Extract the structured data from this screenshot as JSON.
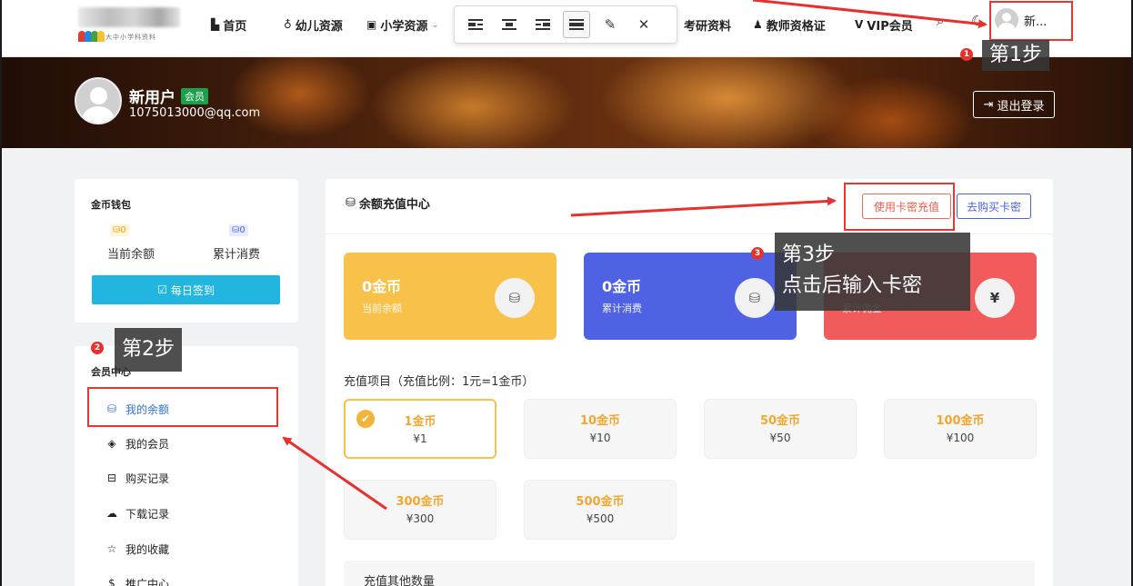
{
  "logo": {
    "subtitle": "大中小学科资料"
  },
  "nav": {
    "items": [
      {
        "label": "首页",
        "icon": "home-icon"
      },
      {
        "label": "幼儿资源",
        "icon": "child-icon"
      },
      {
        "label": "小学资源",
        "icon": "book-icon",
        "has_dropdown": true
      },
      {
        "label": "考研资料",
        "icon": "",
        "partial": true
      },
      {
        "label": "教师资格证",
        "icon": "teacher-icon"
      },
      {
        "label": "VIP会员",
        "icon": "vip-icon"
      }
    ],
    "user_label": "新..."
  },
  "toolbar": {
    "buttons": [
      {
        "name": "align-left-icon"
      },
      {
        "name": "align-center-icon"
      },
      {
        "name": "align-right-icon"
      },
      {
        "name": "align-full-icon",
        "active": true
      },
      {
        "name": "edit-pencil-icon"
      },
      {
        "name": "close-icon"
      }
    ]
  },
  "profile": {
    "name": "新用户",
    "badge": "会员",
    "email": "1075013000@qq.com",
    "logout_label": "退出登录"
  },
  "wallet": {
    "title": "金币钱包",
    "balance_value": "0",
    "spent_value": "0",
    "balance_label": "当前余额",
    "spent_label": "累计消费",
    "checkin_label": "每日签到"
  },
  "member_center": {
    "title": "会员中心",
    "items": [
      {
        "label": "我的余额",
        "icon": "coins-icon",
        "active": true
      },
      {
        "label": "我的会员",
        "icon": "diamond-icon"
      },
      {
        "label": "购买记录",
        "icon": "basket-icon"
      },
      {
        "label": "下载记录",
        "icon": "cloud-download-icon"
      },
      {
        "label": "我的收藏",
        "icon": "star-icon"
      },
      {
        "label": "推广中心",
        "icon": "dollar-icon"
      }
    ]
  },
  "recharge": {
    "title": "余额充值中心",
    "card_button": "使用卡密充值",
    "buy_button": "去购买卡密",
    "stats": [
      {
        "value": "0金币",
        "label": "当前余额",
        "icon": "coins-icon",
        "color": "#f7c14a"
      },
      {
        "value": "0金币",
        "label": "累计消费",
        "icon": "coins-icon",
        "color": "#4f62e3"
      },
      {
        "value": "",
        "label": "累计佣金",
        "icon": "yen-icon",
        "color": "#f15b5b"
      }
    ],
    "options_title": "充值项目（充值比例：1元=1金币）",
    "options": [
      {
        "coins": "1金币",
        "price": "¥1",
        "selected": true
      },
      {
        "coins": "10金币",
        "price": "¥10"
      },
      {
        "coins": "50金币",
        "price": "¥50"
      },
      {
        "coins": "100金币",
        "price": "¥100"
      },
      {
        "coins": "300金币",
        "price": "¥300"
      },
      {
        "coins": "500金币",
        "price": "¥500"
      }
    ],
    "other_label": "充值其他数量"
  },
  "annotations": {
    "step1": {
      "num": "1",
      "text": "第1步"
    },
    "step2": {
      "num": "2",
      "text": "第2步"
    },
    "step3": {
      "num": "3",
      "line1": "第3步",
      "line2": "点击后输入卡密"
    },
    "color": "#e6322f"
  }
}
